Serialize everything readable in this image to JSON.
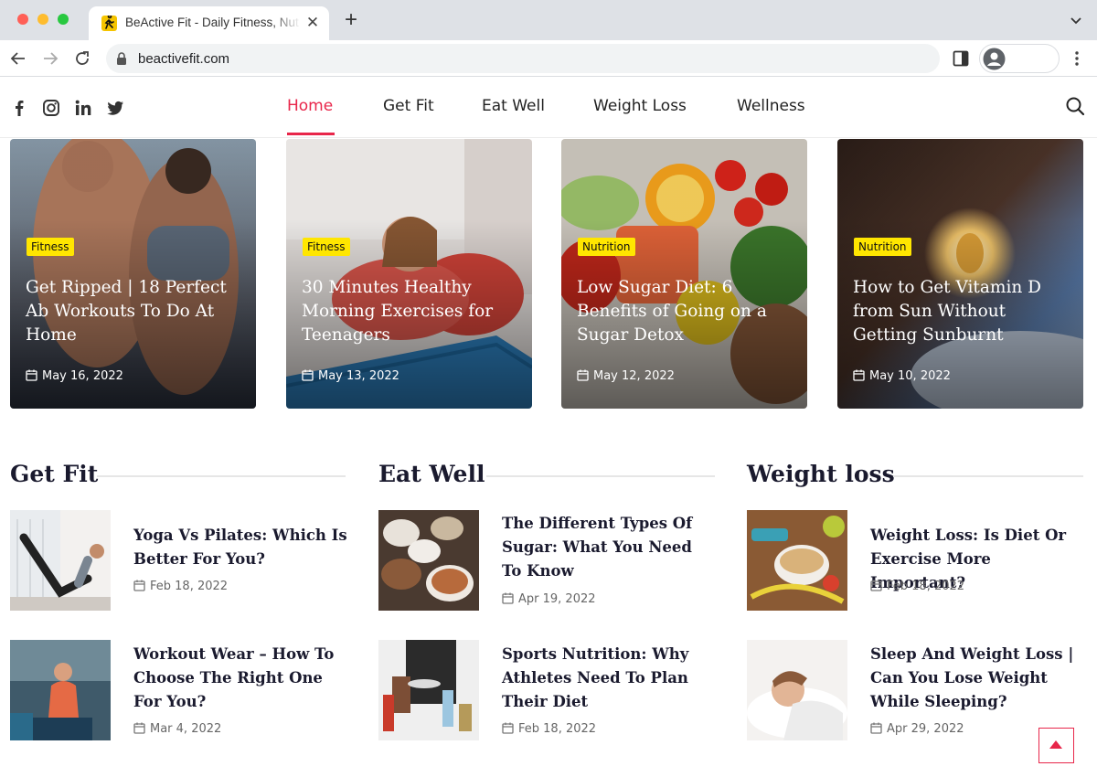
{
  "browser": {
    "tab_title": "BeActive Fit - Daily Fitness, Nutrition",
    "url": "beactivefit.com"
  },
  "nav": {
    "items": [
      {
        "label": "Home",
        "active": true
      },
      {
        "label": "Get Fit",
        "active": false
      },
      {
        "label": "Eat Well",
        "active": false
      },
      {
        "label": "Weight Loss",
        "active": false
      },
      {
        "label": "Wellness",
        "active": false
      }
    ]
  },
  "featured": [
    {
      "category": "Fitness",
      "title": "Get Ripped | 18 Perfect Ab Workouts To Do At Home",
      "date": "May 16, 2022"
    },
    {
      "category": "Fitness",
      "title": "30 Minutes Healthy Morning Exercises for Teenagers",
      "date": "May 13, 2022"
    },
    {
      "category": "Nutrition",
      "title": "Low Sugar Diet: 6 Benefits of Going on a Sugar Detox",
      "date": "May 12, 2022"
    },
    {
      "category": "Nutrition",
      "title": "How to Get Vitamin D from Sun Without Getting Sunburnt",
      "date": "May 10, 2022"
    }
  ],
  "sections": [
    {
      "title": "Get Fit",
      "posts": [
        {
          "title": "Yoga Vs Pilates: Which Is Better For You?",
          "date": "Feb 18, 2022"
        },
        {
          "title": "Workout Wear – How To Choose The Right One For You?",
          "date": "Mar 4, 2022"
        }
      ]
    },
    {
      "title": "Eat Well",
      "posts": [
        {
          "title": "The Different Types Of Sugar: What You Need To Know",
          "date": "Apr 19, 2022"
        },
        {
          "title": "Sports Nutrition: Why Athletes Need To Plan Their Diet",
          "date": "Feb 18, 2022"
        }
      ]
    },
    {
      "title": "Weight loss",
      "posts": [
        {
          "title": "Weight Loss: Is Diet Or Exercise More Important?",
          "date": "Feb 18, 2022"
        },
        {
          "title": "Sleep And Weight Loss | Can You Lose Weight While Sleeping?",
          "date": "Apr 29, 2022"
        }
      ]
    }
  ],
  "colors": {
    "accent": "#e8264a",
    "badge": "#ffe600",
    "heading": "#1a1a2e"
  }
}
